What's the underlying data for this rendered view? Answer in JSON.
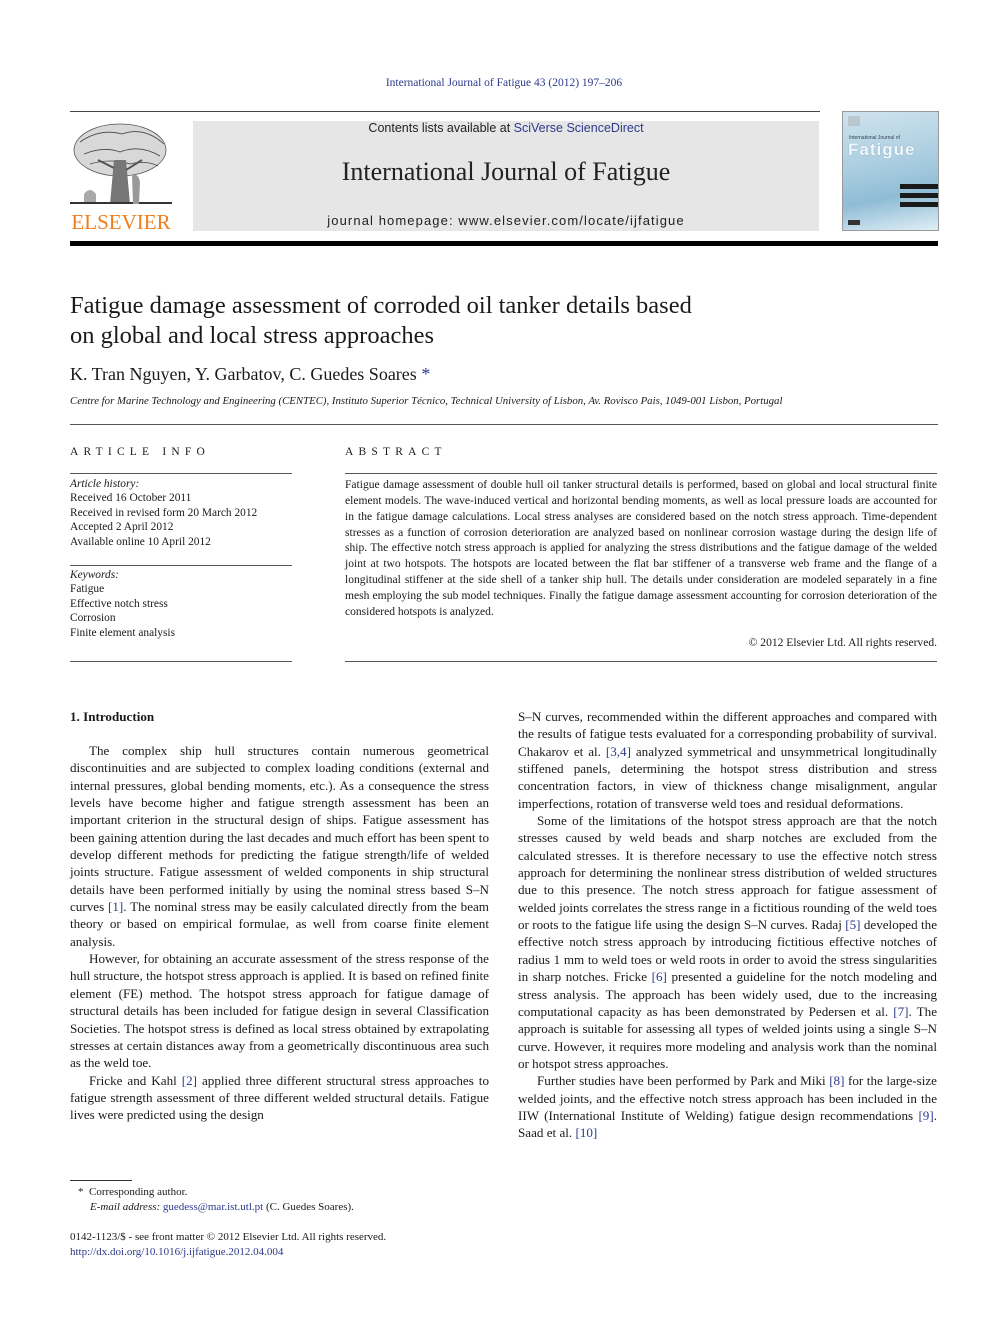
{
  "header": {
    "citation": "International Journal of Fatigue 43 (2012) 197–206",
    "contents_prefix": "Contents lists available at ",
    "contents_link": "SciVerse ScienceDirect",
    "journal_name": "International Journal of Fatigue",
    "homepage": "journal homepage: www.elsevier.com/locate/ijfatigue",
    "publisher_logo_text": "ELSEVIER",
    "cover": {
      "small_title": "International Journal of",
      "big_title": "Fatigue"
    }
  },
  "colors": {
    "link": "#2c3a8c",
    "elsevier_orange": "#f07d1b",
    "masthead_bg": "#e6e6e6"
  },
  "article": {
    "title_line1": "Fatigue damage assessment of corroded oil tanker details based",
    "title_line2": "on global and local stress approaches",
    "authors": "K. Tran Nguyen, Y. Garbatov, C. Guedes Soares",
    "corresponding_mark": "*",
    "affiliation": "Centre for Marine Technology and Engineering (CENTEC), Instituto Superior Técnico, Technical University of Lisbon, Av. Rovisco Pais, 1049-001 Lisbon, Portugal"
  },
  "article_info": {
    "heading": "ARTICLE INFO",
    "history_label": "Article history:",
    "history": [
      "Received 16 October 2011",
      "Received in revised form 20 March 2012",
      "Accepted 2 April 2012",
      "Available online 10 April 2012"
    ],
    "keywords_label": "Keywords:",
    "keywords": [
      "Fatigue",
      "Effective notch stress",
      "Corrosion",
      "Finite element analysis"
    ]
  },
  "abstract": {
    "heading": "ABSTRACT",
    "text": "Fatigue damage assessment of double hull oil tanker structural details is performed, based on global and local structural finite element models. The wave-induced vertical and horizontal bending moments, as well as local pressure loads are accounted for in the fatigue damage calculations. Local stress analyses are considered based on the notch stress approach. Time-dependent stresses as a function of corrosion deterioration are analyzed based on nonlinear corrosion wastage during the design life of ship. The effective notch stress approach is applied for analyzing the stress distributions and the fatigue damage of the welded joint at two hotspots. The hotspots are located between the flat bar stiffener of a transverse web frame and the flange of a longitudinal stiffener at the side shell of a tanker ship hull. The details under consideration are modeled separately in a fine mesh employing the sub model techniques. Finally the fatigue damage assessment accounting for corrosion deterioration of the considered hotspots is analyzed.",
    "copyright": "© 2012 Elsevier Ltd. All rights reserved."
  },
  "body": {
    "section_heading": "1. Introduction",
    "left_column": [
      {
        "parts": [
          {
            "t": "The complex ship hull structures contain numerous geometrical discontinuities and are subjected to complex loading conditions (external and internal pressures, global bending moments, etc.). As a consequence the stress levels have become higher and fatigue strength assessment has been an important criterion in the structural design of ships. Fatigue assessment has been gaining attention during the last decades and much effort has been spent to develop different methods for predicting the fatigue strength/life of welded joints structure. Fatigue assessment of welded components in ship structural details have been performed initially by using the nominal stress based S–N curves "
          },
          {
            "ref": "[1]"
          },
          {
            "t": ". The nominal stress may be easily calculated directly from the beam theory or based on empirical formulae, as well from coarse finite element analysis."
          }
        ]
      },
      {
        "parts": [
          {
            "t": "However, for obtaining an accurate assessment of the stress response of the hull structure, the hotspot stress approach is applied. It is based on refined finite element (FE) method. The hotspot stress approach for fatigue damage of structural details has been included for fatigue design in several Classification Societies. The hotspot stress is defined as local stress obtained by extrapolating stresses at certain distances away from a geometrically discontinuous area such as the weld toe."
          }
        ]
      },
      {
        "parts": [
          {
            "t": "Fricke and Kahl "
          },
          {
            "ref": "[2]"
          },
          {
            "t": " applied three different structural stress approaches to fatigue strength assessment of three different welded structural details. Fatigue lives were predicted using the design"
          }
        ]
      }
    ],
    "right_column": [
      {
        "noindent": true,
        "parts": [
          {
            "t": "S–N curves, recommended within the different approaches and compared with the results of fatigue tests evaluated for a corresponding probability of survival. Chakarov et al. "
          },
          {
            "ref": "[3,4]"
          },
          {
            "t": " analyzed symmetrical and unsymmetrical longitudinally stiffened panels, determining the hotspot stress distribution and stress concentration factors, in view of thickness change misalignment, angular imperfections, rotation of transverse weld toes and residual deformations."
          }
        ]
      },
      {
        "parts": [
          {
            "t": "Some of the limitations of the hotspot stress approach are that the notch stresses caused by weld beads and sharp notches are excluded from the calculated stresses. It is therefore necessary to use the effective notch stress approach for determining the nonlinear stress distribution of welded structures due to this presence. The notch stress approach for fatigue assessment of welded joints correlates the stress range in a fictitious rounding of the weld toes or roots to the fatigue life using the design S–N curves. Radaj "
          },
          {
            "ref": "[5]"
          },
          {
            "t": " developed the effective notch stress approach by introducing fictitious effective notches of radius 1 mm to weld toes or weld roots in order to avoid the stress singularities in sharp notches. Fricke "
          },
          {
            "ref": "[6]"
          },
          {
            "t": " presented a guideline for the notch modeling and stress analysis. The approach has been widely used, due to the increasing computational capacity as has been demonstrated by Pedersen et al. "
          },
          {
            "ref": "[7]"
          },
          {
            "t": ". The approach is suitable for assessing all types of welded joints using a single S–N curve. However, it requires more modeling and analysis work than the nominal or hotspot stress approaches."
          }
        ]
      },
      {
        "parts": [
          {
            "t": "Further studies have been performed by Park and Miki "
          },
          {
            "ref": "[8]"
          },
          {
            "t": " for the large-size welded joints, and the effective notch stress approach has been included in the IIW (International Institute of Welding) fatigue design recommendations "
          },
          {
            "ref": "[9]"
          },
          {
            "t": ". Saad et al. "
          },
          {
            "ref": "[10]"
          }
        ]
      }
    ]
  },
  "footnote": {
    "mark": "*",
    "corresponding": "Corresponding author.",
    "email_label": "E-mail address:",
    "email": "guedess@mar.ist.utl.pt",
    "email_suffix": " (C. Guedes Soares)."
  },
  "front_matter": {
    "issn_line": "0142-1123/$ - see front matter © 2012 Elsevier Ltd. All rights reserved.",
    "doi": "http://dx.doi.org/10.1016/j.ijfatigue.2012.04.004"
  }
}
